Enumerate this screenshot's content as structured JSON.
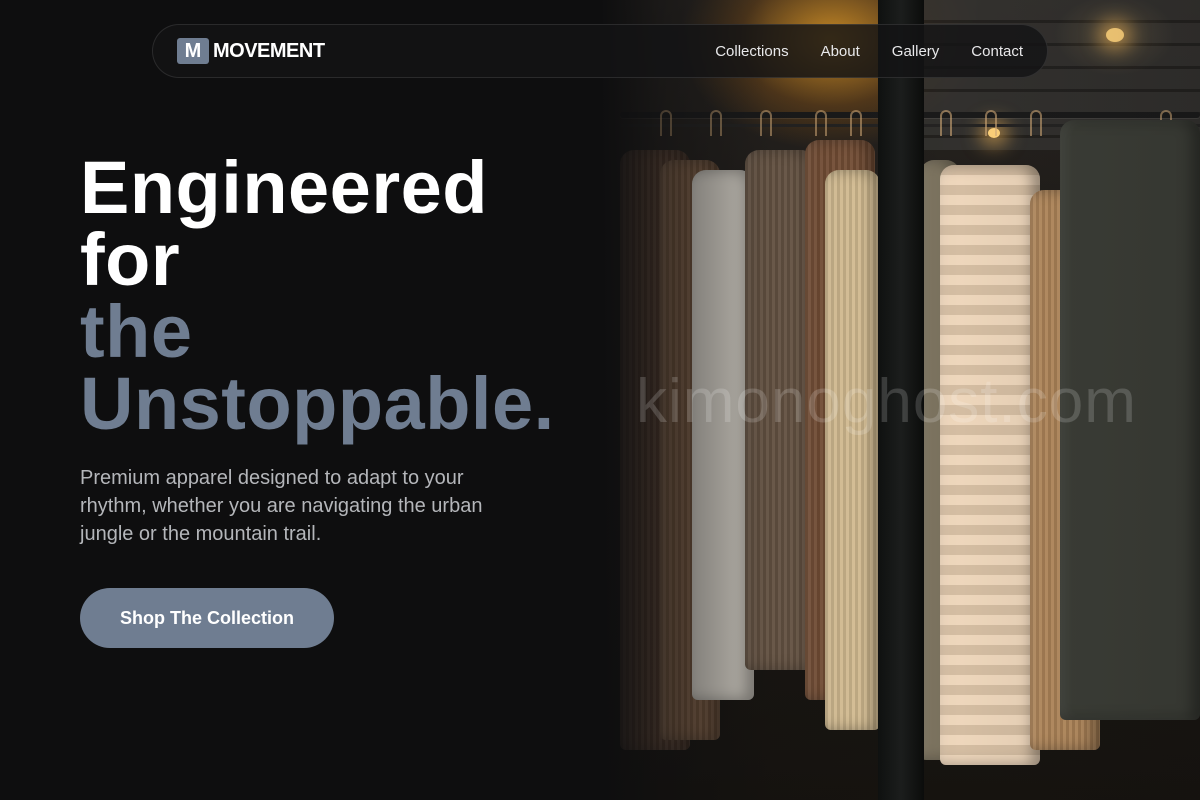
{
  "brand": {
    "mark": "M",
    "name": "MOVEMENT"
  },
  "nav": {
    "items": [
      {
        "label": "Collections"
      },
      {
        "label": "About"
      },
      {
        "label": "Gallery"
      },
      {
        "label": "Contact"
      }
    ]
  },
  "hero": {
    "headline_lines": [
      "Engineered",
      "for",
      "the",
      "Unstoppable."
    ],
    "subtitle": "Premium apparel designed to adapt to your rhythm, whether you are navigating the urban jungle or the mountain trail.",
    "cta_label": "Shop The Collection",
    "image_watermark": "kimonoghost.com"
  },
  "colors": {
    "background": "#0e0e0f",
    "accent": "#6f7d91",
    "text": "#ffffff",
    "muted_text": "#b4b6ba"
  }
}
